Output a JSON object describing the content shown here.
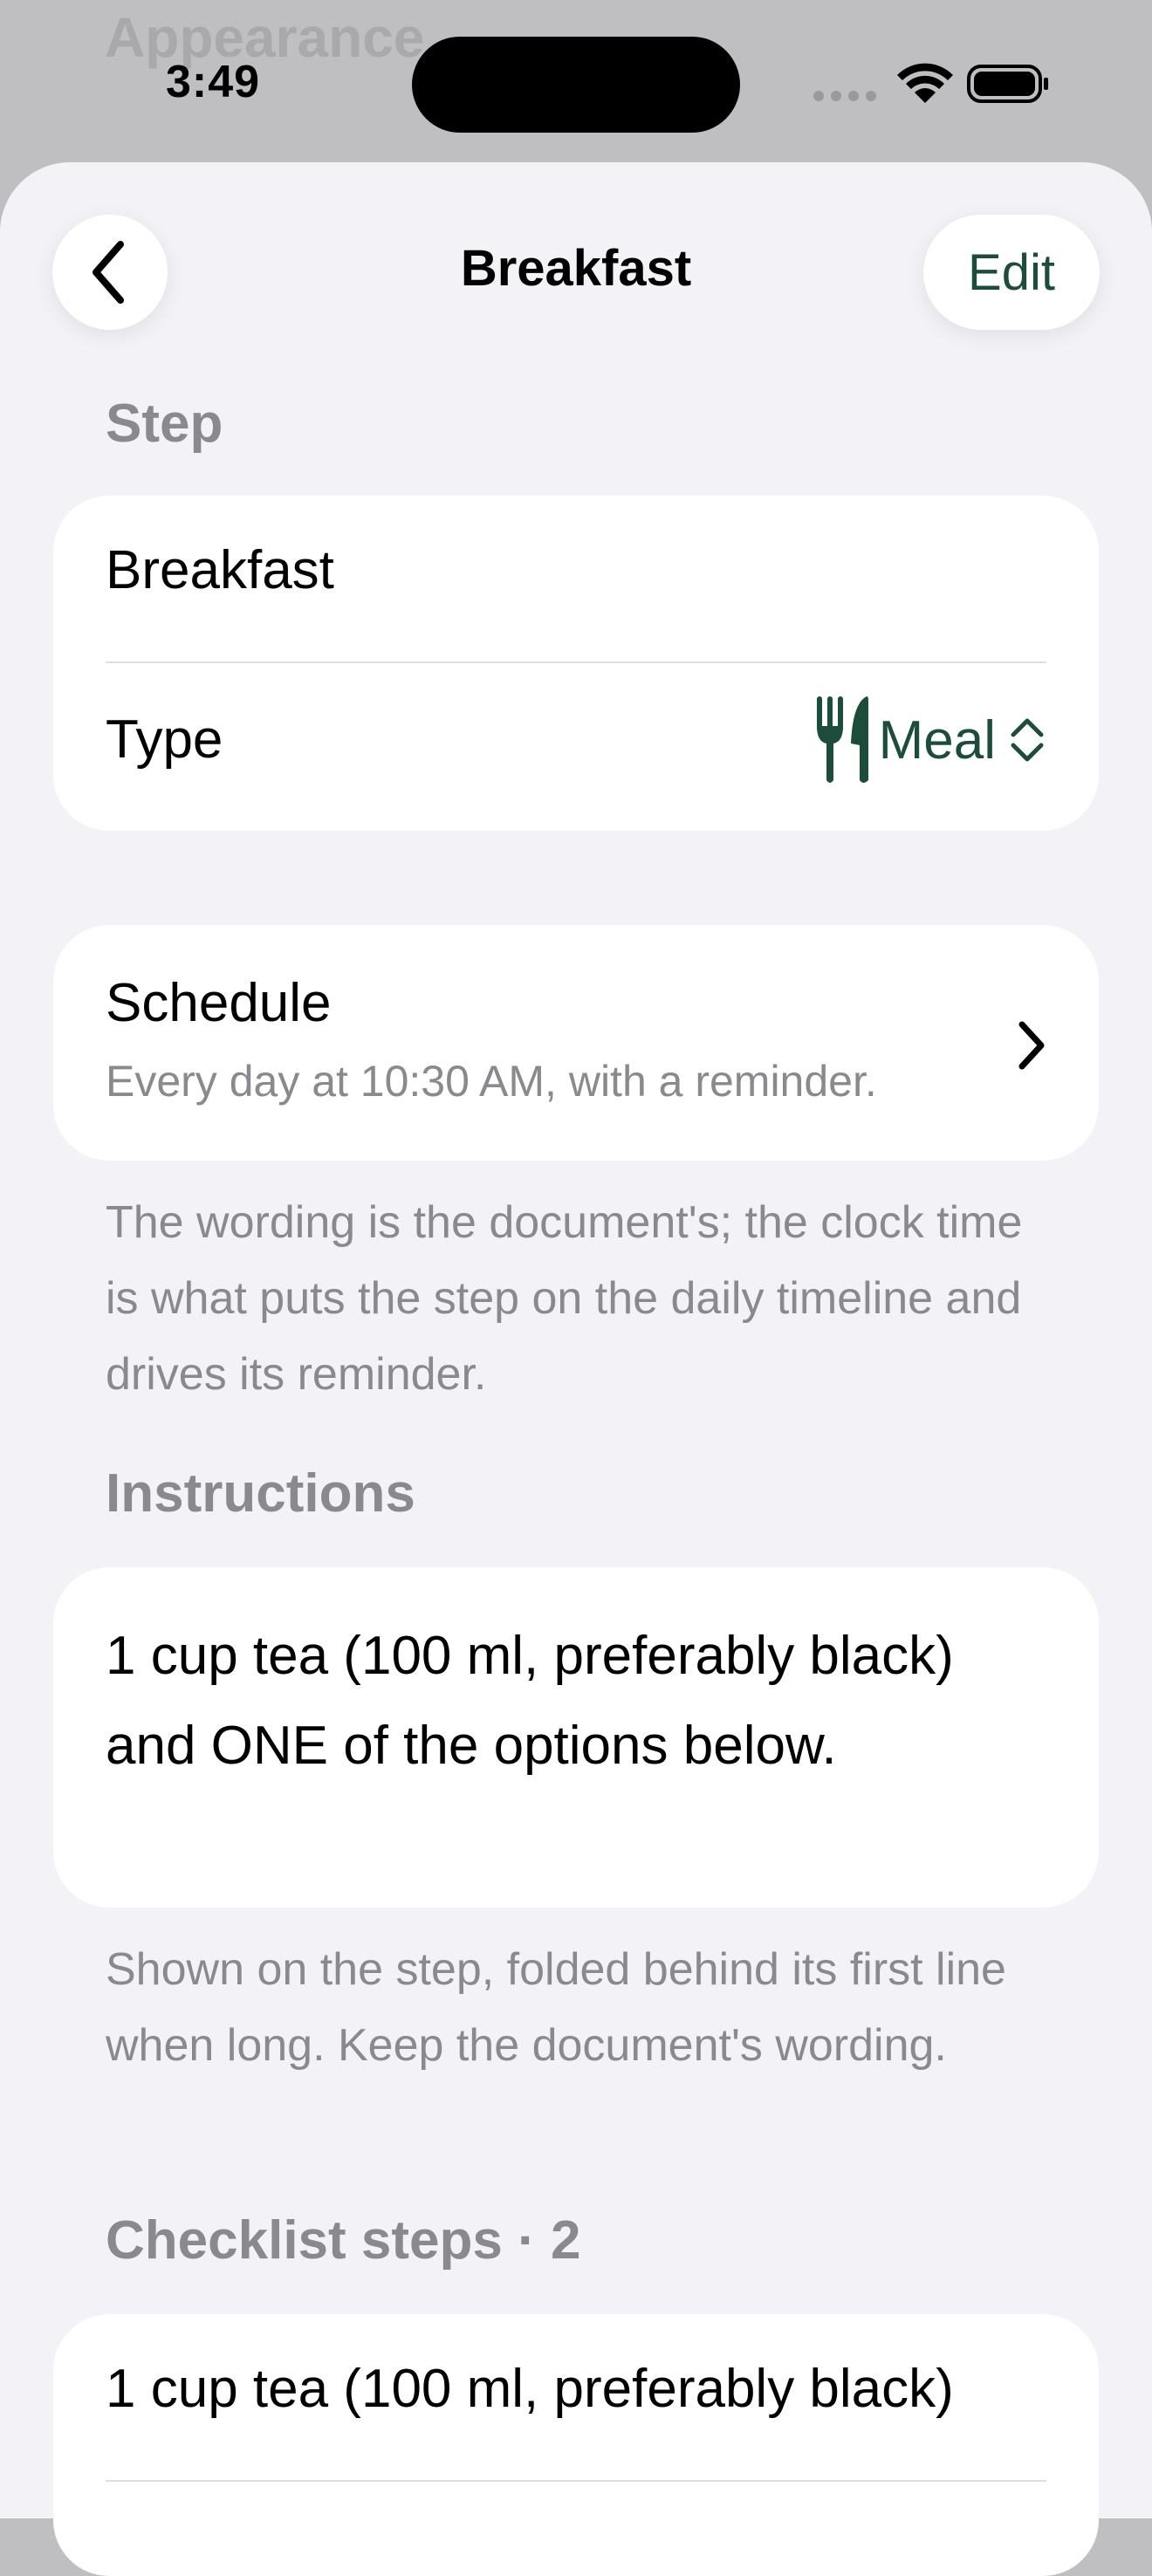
{
  "background": {
    "title": "Appearance"
  },
  "status_bar": {
    "time": "3:49",
    "icons": [
      "more-dots-icon",
      "wifi-icon",
      "battery-icon"
    ]
  },
  "nav": {
    "title": "Breakfast",
    "back_icon": "chevron-left-icon",
    "edit_label": "Edit"
  },
  "step_section": {
    "header": "Step",
    "name": "Breakfast",
    "type_label": "Type",
    "type_value": "Meal",
    "type_icon": "fork-knife-icon",
    "type_picker_icon": "chevron-up-down-icon"
  },
  "schedule": {
    "title": "Schedule",
    "subtitle": "Every day at 10:30 AM, with a reminder.",
    "footnote": "The wording is the document's; the clock time is what puts the step on the daily timeline and drives its reminder."
  },
  "instructions": {
    "header": "Instructions",
    "text": "1 cup tea (100 ml, preferably black) and ONE of the options below.",
    "footnote": "Shown on the step, folded behind its first line when long. Keep the document's wording."
  },
  "checklist": {
    "header": "Checklist steps · 2",
    "items": [
      "1 cup tea (100 ml, preferably black)"
    ]
  },
  "colors": {
    "accent": "#1c4d3a",
    "background": "#f2f2f7",
    "secondary_text": "#8a8a8e"
  }
}
